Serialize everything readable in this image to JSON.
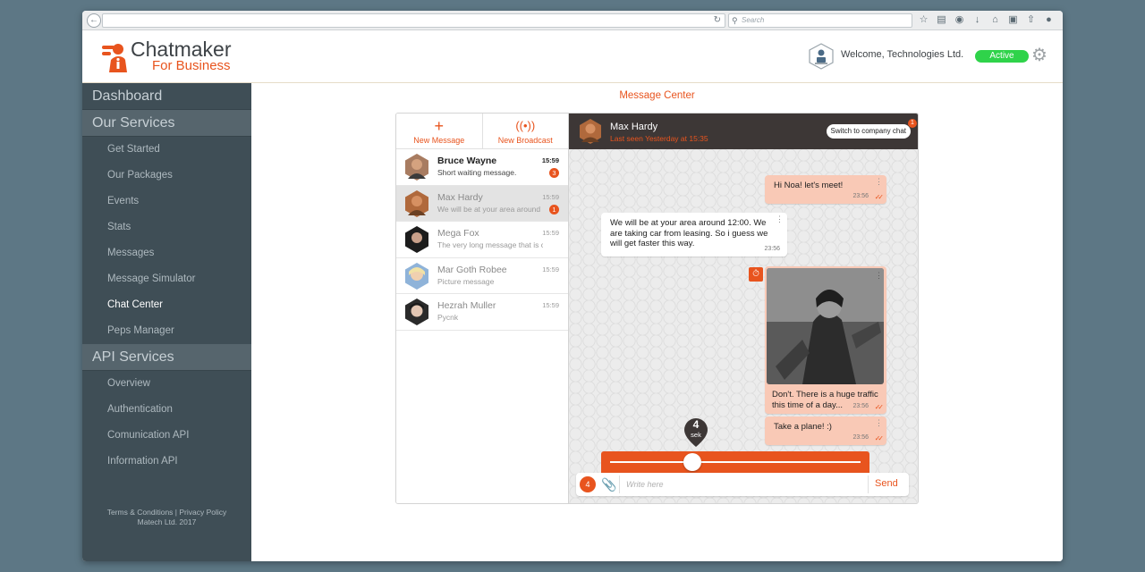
{
  "browser": {
    "search_placeholder": "Search"
  },
  "header": {
    "brand": "Chatmaker",
    "brand_sub": "For Business",
    "welcome": "Welcome, Technologies Ltd.",
    "status": "Active"
  },
  "sidebar": {
    "dashboard": "Dashboard",
    "our_services": "Our Services",
    "services_items": [
      {
        "label": "Get Started"
      },
      {
        "label": "Our Packages"
      },
      {
        "label": "Events"
      },
      {
        "label": "Stats"
      },
      {
        "label": "Messages"
      },
      {
        "label": "Message Simulator"
      },
      {
        "label": "Chat Center"
      },
      {
        "label": "Peps Manager"
      }
    ],
    "api_services": "API Services",
    "api_items": [
      {
        "label": "Overview"
      },
      {
        "label": "Authentication"
      },
      {
        "label": "Comunication API"
      },
      {
        "label": "Information API"
      }
    ],
    "footer_line1": "Terms & Conditions  |  Privacy Policy",
    "footer_line2": "Matech Ltd. 2017"
  },
  "main": {
    "title": "Message Center"
  },
  "actions": {
    "new_message": "New Message",
    "new_broadcast": "New Broadcast"
  },
  "contacts": [
    {
      "name": "Bruce Wayne",
      "message": "Short waiting message.",
      "time": "15:59",
      "badge": "3"
    },
    {
      "name": "Max Hardy",
      "message": "We will be at your area around 12:00",
      "time": "15:59",
      "badge": "1"
    },
    {
      "name": "Mega Fox",
      "message": "The very long message that is cut",
      "time": "15:59"
    },
    {
      "name": "Mar Goth Robee",
      "message": "Picture message",
      "time": "15:59"
    },
    {
      "name": "Hezrah Muller",
      "message": "Pycnk",
      "time": "15:59"
    }
  ],
  "chat": {
    "name": "Max Hardy",
    "last_seen": "Last seen Yesterday at 15:35",
    "switch_label": "Switch to company chat",
    "switch_badge": "1",
    "messages": [
      {
        "text": "Hi Noa! let's meet!",
        "time": "23:56"
      },
      {
        "text": "We will be at your area around 12:00. We are taking car from leasing. So i guess we will get faster this way.",
        "time": "23:56"
      },
      {
        "text": "Don't. There is a huge traffic this time of a day...",
        "time": "23:56"
      },
      {
        "text": "Take a plane! :)",
        "time": "23:56"
      }
    ],
    "timer_value": "4",
    "timer_unit": "sek",
    "timer_level": 0.33
  },
  "compose": {
    "timer": "4",
    "placeholder": "Write here",
    "send": "Send"
  },
  "colors": {
    "accent": "#e8541e",
    "sidebar": "#3f4e56",
    "chat_header": "#3d3736",
    "active": "#2fd34a"
  }
}
